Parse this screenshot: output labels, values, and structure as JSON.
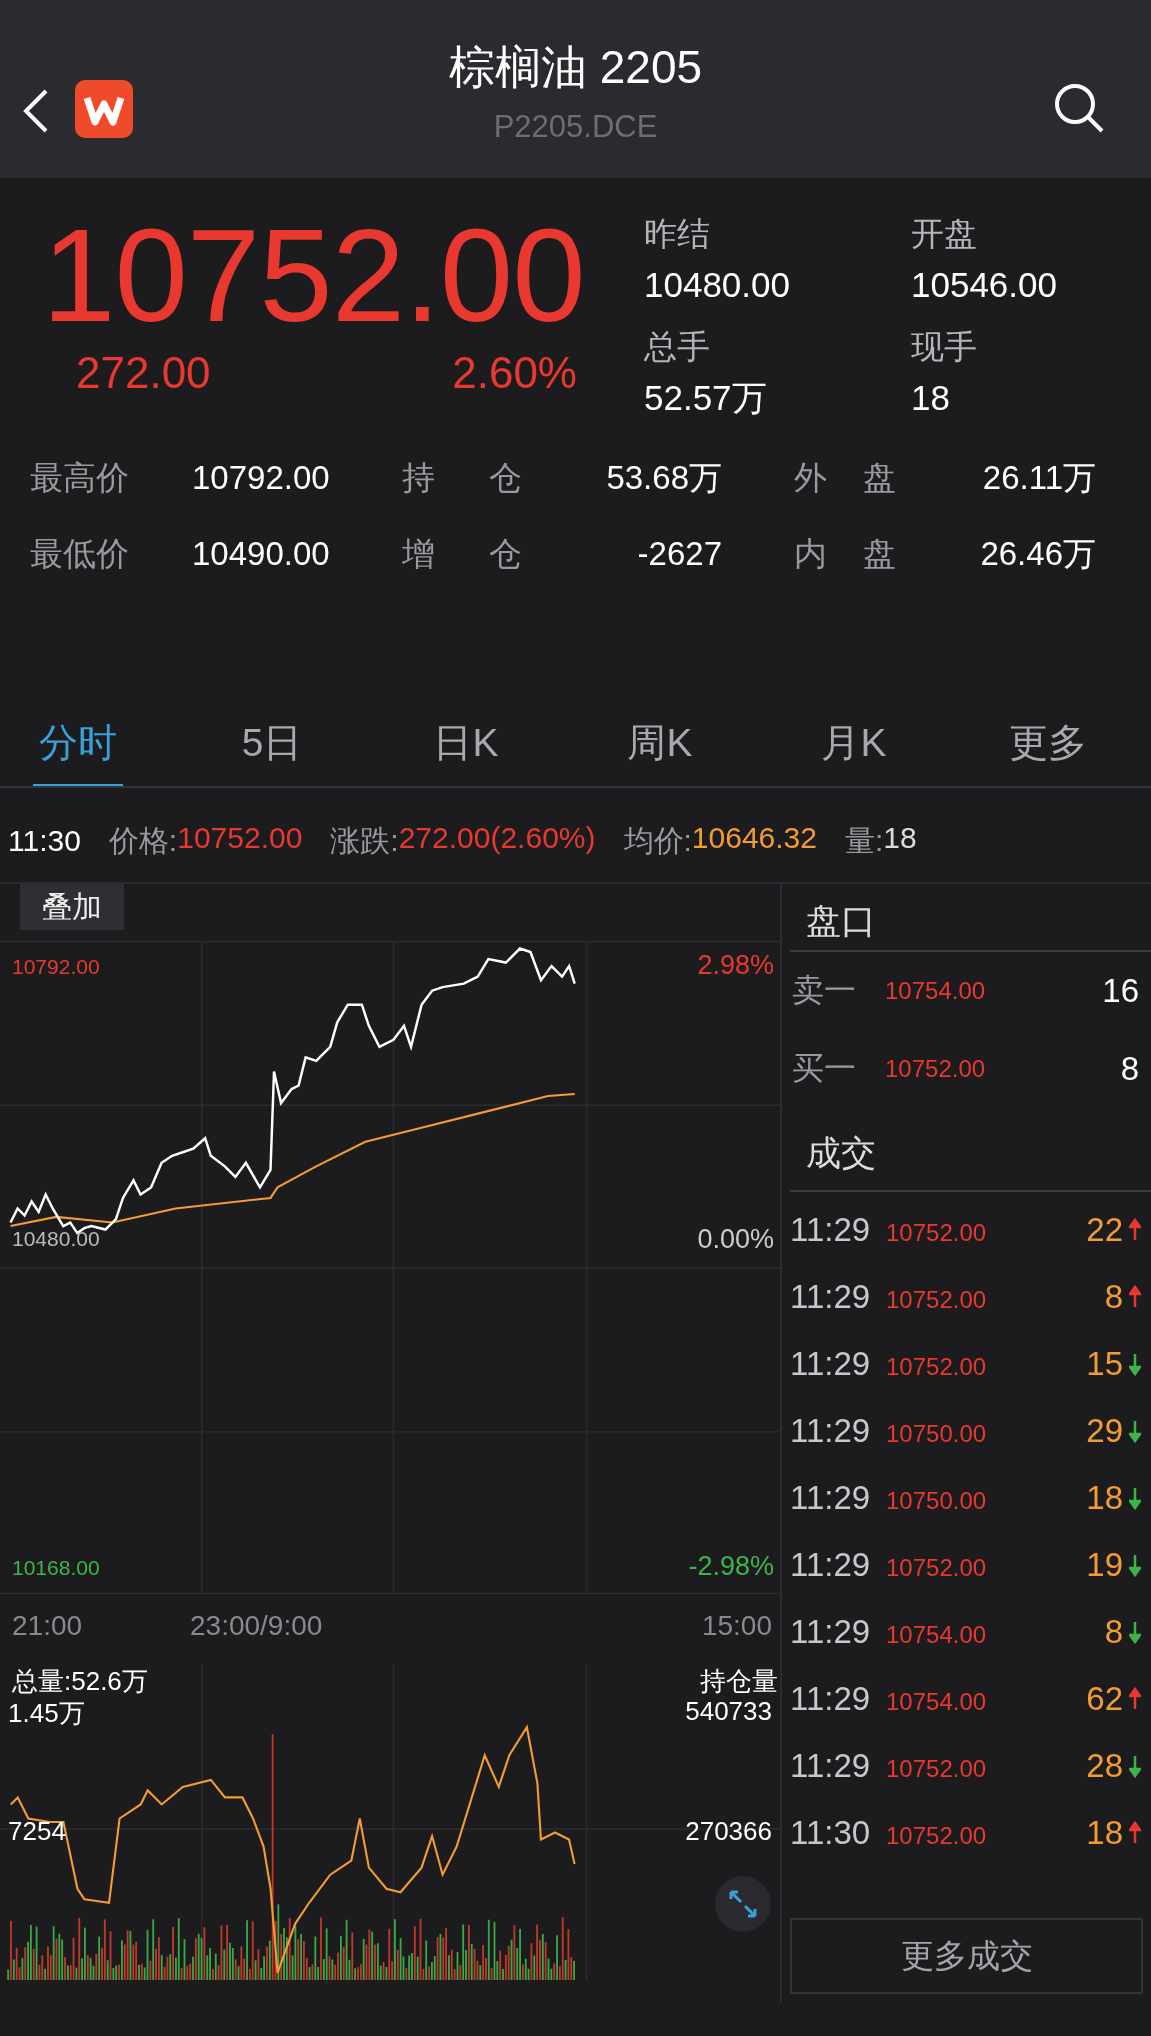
{
  "header": {
    "title": "棕榈油 2205",
    "code": "P2205.DCE"
  },
  "quote": {
    "price": "10752.00",
    "change": "272.00",
    "change_pct": "2.60%"
  },
  "stats": [
    {
      "label": "昨结",
      "value": "10480.00"
    },
    {
      "label": "开盘",
      "value": "10546.00"
    },
    {
      "label": "总手",
      "value": "52.57万"
    },
    {
      "label": "现手",
      "value": "18"
    }
  ],
  "details": [
    [
      {
        "label": "最高价",
        "value": "10792.00"
      },
      {
        "label": "持 仓",
        "value": "53.68万"
      },
      {
        "label": "外 盘",
        "value": "26.11万"
      }
    ],
    [
      {
        "label": "最低价",
        "value": "10490.00"
      },
      {
        "label": "增 仓",
        "value": "-2627"
      },
      {
        "label": "内 盘",
        "value": "26.46万"
      }
    ]
  ],
  "tabs": [
    {
      "label": "分时",
      "selected": true
    },
    {
      "label": "5日",
      "selected": false
    },
    {
      "label": "日K",
      "selected": false
    },
    {
      "label": "周K",
      "selected": false
    },
    {
      "label": "月K",
      "selected": false
    },
    {
      "label": "更多",
      "selected": false
    }
  ],
  "info": {
    "time": "11:30",
    "items": [
      {
        "label": "价格:",
        "value": "10752.00",
        "kind": "up"
      },
      {
        "label": "涨跌:",
        "value": "272.00(2.60%)",
        "kind": "up"
      },
      {
        "label": "均价:",
        "value": "10646.32",
        "kind": "avg"
      },
      {
        "label": "量:",
        "value": "18",
        "kind": "plain"
      }
    ]
  },
  "chart": {
    "overlay_button": "叠加",
    "price_high": "10792.00",
    "price_base": "10480.00",
    "price_low": "10168.00",
    "pct_high": "2.98%",
    "pct_base": "0.00%",
    "pct_low": "-2.98%",
    "time_labels": [
      "21:00",
      "23:00/9:00",
      "15:00"
    ],
    "volume_total": "总量:52.6万",
    "volume_max": "1.45万",
    "volume_mid": "7254",
    "oi_title": "持仓量",
    "oi_max": "540733",
    "oi_mid": "270366"
  },
  "order_book": {
    "title": "盘口",
    "levels": [
      {
        "label": "卖一",
        "price": "10754.00",
        "volume": "16"
      },
      {
        "label": "买一",
        "price": "10752.00",
        "volume": "8"
      }
    ]
  },
  "trades": {
    "title": "成交",
    "rows": [
      {
        "time": "11:29",
        "price": "10752.00",
        "volume": "22",
        "up": true
      },
      {
        "time": "11:29",
        "price": "10752.00",
        "volume": "8",
        "up": true
      },
      {
        "time": "11:29",
        "price": "10752.00",
        "volume": "15",
        "up": false
      },
      {
        "time": "11:29",
        "price": "10750.00",
        "volume": "29",
        "up": false
      },
      {
        "time": "11:29",
        "price": "10750.00",
        "volume": "18",
        "up": false
      },
      {
        "time": "11:29",
        "price": "10752.00",
        "volume": "19",
        "up": false
      },
      {
        "time": "11:29",
        "price": "10754.00",
        "volume": "8",
        "up": false
      },
      {
        "time": "11:29",
        "price": "10754.00",
        "volume": "62",
        "up": true
      },
      {
        "time": "11:29",
        "price": "10752.00",
        "volume": "28",
        "up": false
      },
      {
        "time": "11:30",
        "price": "10752.00",
        "volume": "18",
        "up": true
      }
    ],
    "more_button": "更多成交"
  }
}
